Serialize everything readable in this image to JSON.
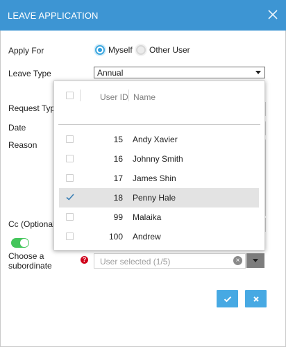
{
  "window": {
    "title": "LEAVE APPLICATION"
  },
  "form": {
    "apply_for_label": "Apply For",
    "apply_for_options": [
      {
        "label": "Myself",
        "selected": true
      },
      {
        "label": "Other User",
        "selected": false
      }
    ],
    "leave_type_label": "Leave Type",
    "leave_type_value": "Annual",
    "request_type_label": "Request Type",
    "date_label": "Date",
    "reason_label": "Reason",
    "cc_label": "Cc (Optional)",
    "subordinate_toggle_on": true,
    "subordinate_label_line1": "Choose a",
    "subordinate_label_line2": "subordinate",
    "user_select_placeholder": "User selected (1/5)"
  },
  "dropdown": {
    "columns": {
      "user_id": "User ID",
      "name": "Name"
    },
    "rows": [
      {
        "user_id": "15",
        "name": "Andy Xavier",
        "checked": false
      },
      {
        "user_id": "16",
        "name": "Johnny Smith",
        "checked": false
      },
      {
        "user_id": "17",
        "name": "James Shin",
        "checked": false
      },
      {
        "user_id": "18",
        "name": "Penny Hale",
        "checked": true
      },
      {
        "user_id": "99",
        "name": "Malaika",
        "checked": false
      },
      {
        "user_id": "100",
        "name": "Andrew",
        "checked": false
      }
    ]
  },
  "icons": {
    "close": "close-icon",
    "help": "question-icon",
    "clear": "clear-icon",
    "confirm": "check-icon",
    "cancel": "x-icon"
  },
  "colors": {
    "titlebar": "#3d95d3",
    "accent": "#47a9e3",
    "toggle_on": "#45c65c",
    "help_red": "#d0021b"
  }
}
